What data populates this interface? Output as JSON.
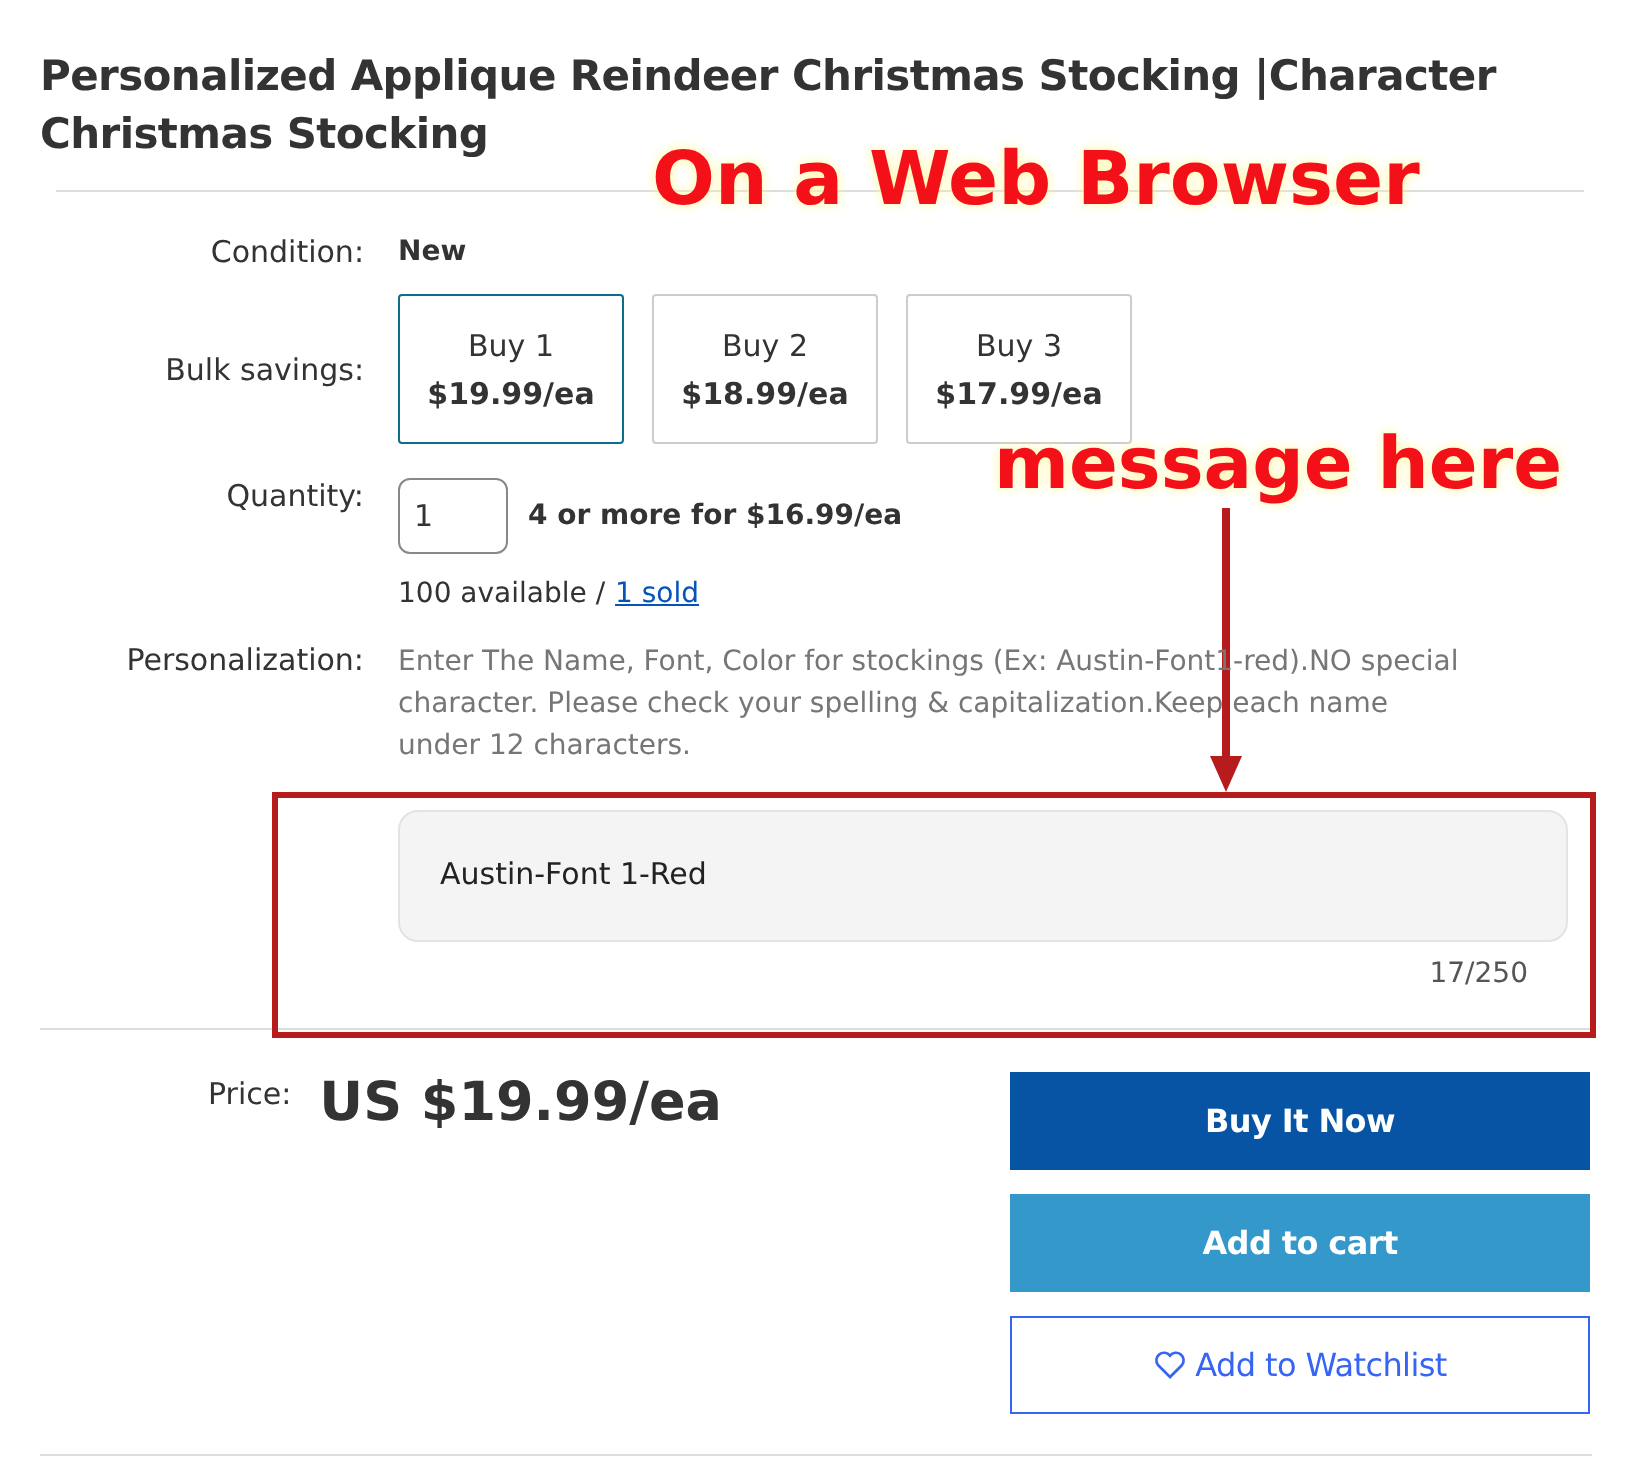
{
  "title": "Personalized Applique Reindeer Christmas Stocking |Character Christmas Stocking",
  "condition": {
    "label": "Condition:",
    "value": "New"
  },
  "bulk_savings": {
    "label": "Bulk savings:",
    "options": [
      {
        "quantity": "Buy 1",
        "price": "$19.99/ea",
        "selected": true
      },
      {
        "quantity": "Buy 2",
        "price": "$18.99/ea",
        "selected": false
      },
      {
        "quantity": "Buy 3",
        "price": "$17.99/ea",
        "selected": false
      }
    ]
  },
  "quantity": {
    "label": "Quantity:",
    "value": "1",
    "offer": "4 or more for $16.99/ea",
    "available": "100 available /",
    "sold_link": "1 sold"
  },
  "personalization": {
    "label": "Personalization:",
    "instructions": "Enter The Name, Font, Color for stockings (Ex: Austin-Font1-red).NO special character. Please check your spelling & capitalization.Keep each name under 12 characters.",
    "value": "Austin-Font 1-Red",
    "counter": "17/250"
  },
  "price": {
    "label": "Price:",
    "value": "US $19.99/ea"
  },
  "buttons": [
    {
      "kind": "primary",
      "label": "Buy It Now"
    },
    {
      "kind": "secondary",
      "label": "Add to cart"
    },
    {
      "kind": "outline",
      "label": "Add to Watchlist"
    }
  ],
  "annotations": [
    {
      "text": "On a Web Browser"
    },
    {
      "text": "message here"
    }
  ]
}
